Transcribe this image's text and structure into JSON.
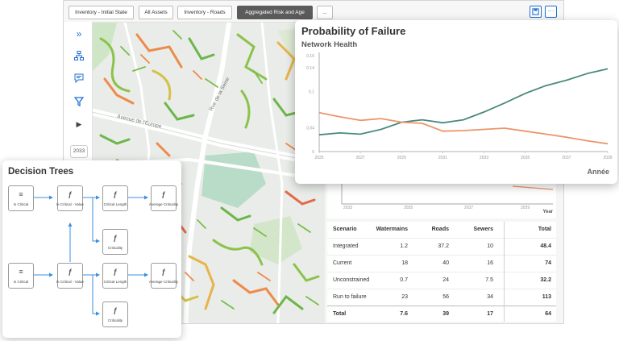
{
  "toolbar": {
    "tabs": [
      "Inventory - Initial State",
      "All Assets",
      "Inventory - Roads",
      "Aggregated Risk and Age"
    ],
    "more_label": "...",
    "save_icon": "save-icon",
    "overflow_label": "···"
  },
  "sidebar": {
    "icons": [
      "chevrons-right-icon",
      "hierarchy-icon",
      "comment-icon",
      "filter-icon",
      "play-icon"
    ],
    "year": "2033"
  },
  "map": {
    "road_labels": [
      "Avenue de l'Europe",
      "Rue de la Seine"
    ]
  },
  "probability_chart": {
    "chart_data": {
      "type": "line",
      "title": "Probability of Failure",
      "subtitle": "Network Health",
      "xlabel": "Année",
      "ylabel": "",
      "ylim": [
        0,
        0.16
      ],
      "y_ticks": [
        "0",
        "0.04",
        "0.1",
        "0.14",
        "0.16"
      ],
      "x": [
        2025,
        2026,
        2027,
        2028,
        2029,
        2030,
        2031,
        2032,
        2033,
        2034,
        2035,
        2036,
        2037,
        2038,
        2039
      ],
      "x_ticks": [
        "2025",
        "2027",
        "2029",
        "2031",
        "2033",
        "2035",
        "2037",
        "2039"
      ],
      "series": [
        {
          "color": "#4a8a7e",
          "values": [
            0.028,
            0.031,
            0.029,
            0.037,
            0.049,
            0.053,
            0.048,
            0.053,
            0.066,
            0.081,
            0.097,
            0.11,
            0.119,
            0.13,
            0.138
          ]
        },
        {
          "color": "#ee946a",
          "values": [
            0.065,
            0.058,
            0.052,
            0.055,
            0.049,
            0.047,
            0.034,
            0.035,
            0.037,
            0.039,
            0.034,
            0.029,
            0.024,
            0.018,
            0.013
          ]
        }
      ]
    }
  },
  "small_chart": {
    "xlabel": "Year",
    "x_ticks": [
      "2033",
      "2035",
      "2037",
      "2039"
    ]
  },
  "table": {
    "headers": [
      "Scenario",
      "Watermains",
      "Roads",
      "Sewers",
      "Total"
    ],
    "rows": [
      [
        "Integrated",
        "1.2",
        "37.2",
        "10",
        "48.4"
      ],
      [
        "Current",
        "18",
        "40",
        "16",
        "74"
      ],
      [
        "Unconstrained",
        "0.7",
        "24",
        "7.5",
        "32.2"
      ],
      [
        "Run to failure",
        "23",
        "56",
        "34",
        "113"
      ]
    ],
    "total": [
      "Total",
      "7.6",
      "39",
      "17",
      "64"
    ]
  },
  "decision_trees": {
    "title": "Decision Trees",
    "nodes": {
      "is_critical_1": "Is Critical",
      "is_critical_value_1": "Is Critical - Value",
      "critical_length_1": "Critical Length",
      "average_criticality_1": "Average Criticality",
      "criticality_1": "Criticality",
      "is_critical_2": "Is Critical",
      "is_critical_value_2": "Is Critical - Value",
      "critical_length_2": "Critical Length",
      "average_criticality_2": "Average Criticality",
      "criticality_2": "Criticality"
    }
  }
}
